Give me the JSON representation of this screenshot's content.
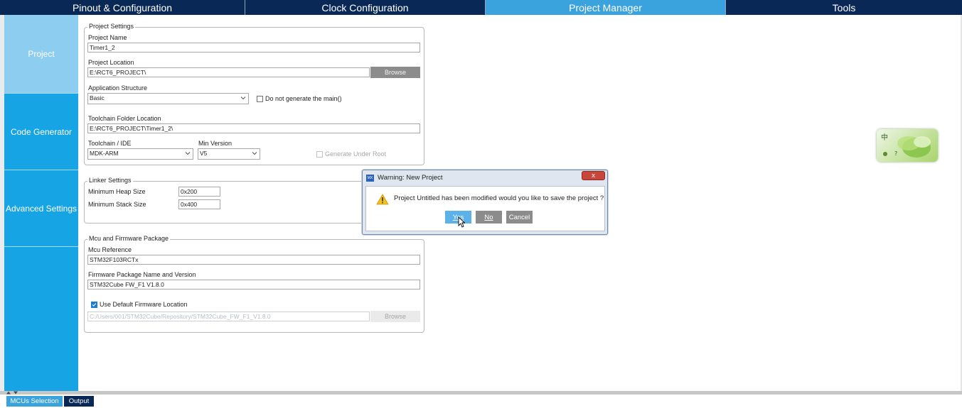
{
  "tabs": [
    {
      "label": "Pinout & Configuration"
    },
    {
      "label": "Clock Configuration"
    },
    {
      "label": "Project Manager"
    },
    {
      "label": "Tools"
    }
  ],
  "sidebar": {
    "items": [
      {
        "label": "Project"
      },
      {
        "label": "Code Generator"
      },
      {
        "label": "Advanced Settings"
      }
    ]
  },
  "project_settings": {
    "legend": "Project Settings",
    "name_label": "Project Name",
    "name_value": "Timer1_2",
    "location_label": "Project Location",
    "location_value": "E:\\RCT6_PROJECT\\",
    "browse_label": "Browse",
    "app_structure_label": "Application Structure",
    "app_structure_value": "Basic",
    "no_main_label": "Do not generate the main()",
    "toolchain_folder_label": "Toolchain Folder Location",
    "toolchain_folder_value": "E:\\RCT6_PROJECT\\Timer1_2\\",
    "toolchain_label": "Toolchain / IDE",
    "toolchain_value": "MDK-ARM",
    "min_version_label": "Min Version",
    "min_version_value": "V5",
    "gen_under_root_label": "Generate Under Root"
  },
  "linker_settings": {
    "legend": "Linker Settings",
    "heap_label": "Minimum Heap Size",
    "heap_value": "0x200",
    "stack_label": "Minimum Stack Size",
    "stack_value": "0x400"
  },
  "mcu_firmware": {
    "legend": "Mcu and Firmware Package",
    "mcu_ref_label": "Mcu Reference",
    "mcu_ref_value": "STM32F103RCTx",
    "fw_label": "Firmware Package Name and Version",
    "fw_value": "STM32Cube FW_F1 V1.8.0",
    "use_default_label": "Use Default Firmware Location",
    "fw_path_value": "C:/Users/001/STM32Cube/Repository/STM32Cube_FW_F1_V1.8.0",
    "browse_label": "Browse"
  },
  "dialog": {
    "logo_text": "MX",
    "title": "Warning: New Project",
    "close_label": "x",
    "message": "Project Untitled has been modified would you like to save the project ?",
    "yes_label": "Yes",
    "no_label": "No",
    "cancel_label": "Cancel"
  },
  "bottom_tabs": [
    {
      "label": "MCUs Selection"
    },
    {
      "label": "Output"
    }
  ],
  "widget": {
    "glyph_1": "中",
    "glyph_2": "?"
  },
  "colors": {
    "tabbar": "#0a2856",
    "active_tab": "#3aa2dc",
    "sidebar": "#16a4e4",
    "sidebar_active": "#8ccdf0",
    "button_gray": "#8c8c8c",
    "dialog_primary": "#5cb1e8"
  }
}
